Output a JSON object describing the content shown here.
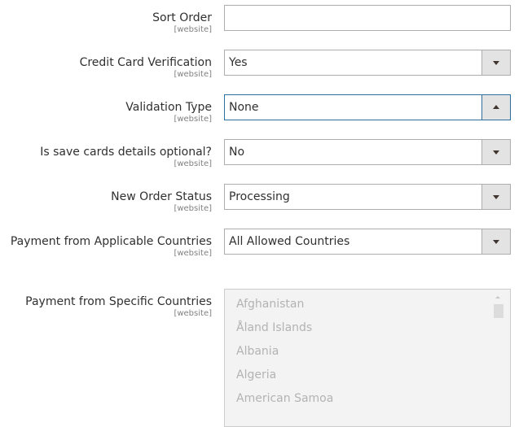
{
  "fields": [
    {
      "label": "Sort Order",
      "scope": "[website]",
      "type": "text",
      "value": ""
    },
    {
      "label": "Credit Card Verification",
      "scope": "[website]",
      "type": "select",
      "value": "Yes"
    },
    {
      "label": "Validation Type",
      "scope": "[website]",
      "type": "select",
      "value": "None",
      "state": "open"
    },
    {
      "label": "Is save cards details optional?",
      "scope": "[website]",
      "type": "select",
      "value": "No"
    },
    {
      "label": "New Order Status",
      "scope": "[website]",
      "type": "select",
      "value": "Processing"
    },
    {
      "label": "Payment from Applicable Countries",
      "scope": "[website]",
      "type": "select",
      "value": "All Allowed Countries"
    }
  ],
  "specific_countries": {
    "label": "Payment from Specific Countries",
    "scope": "[website]",
    "options": [
      "Afghanistan",
      "Åland Islands",
      "Albania",
      "Algeria",
      "American Samoa"
    ],
    "disabled": true
  },
  "icons": {
    "select_arrow": "chevron-down-icon",
    "select_arrow_open": "chevron-up-icon",
    "scroll_up": "scroll-up-arrow-icon"
  },
  "colors": {
    "focus_border": "#2e6f9e",
    "field_border": "#adadad",
    "button_bg": "#e3e3e3",
    "disabled_bg": "#f3f3f3",
    "disabled_text": "#b3b3b3"
  }
}
